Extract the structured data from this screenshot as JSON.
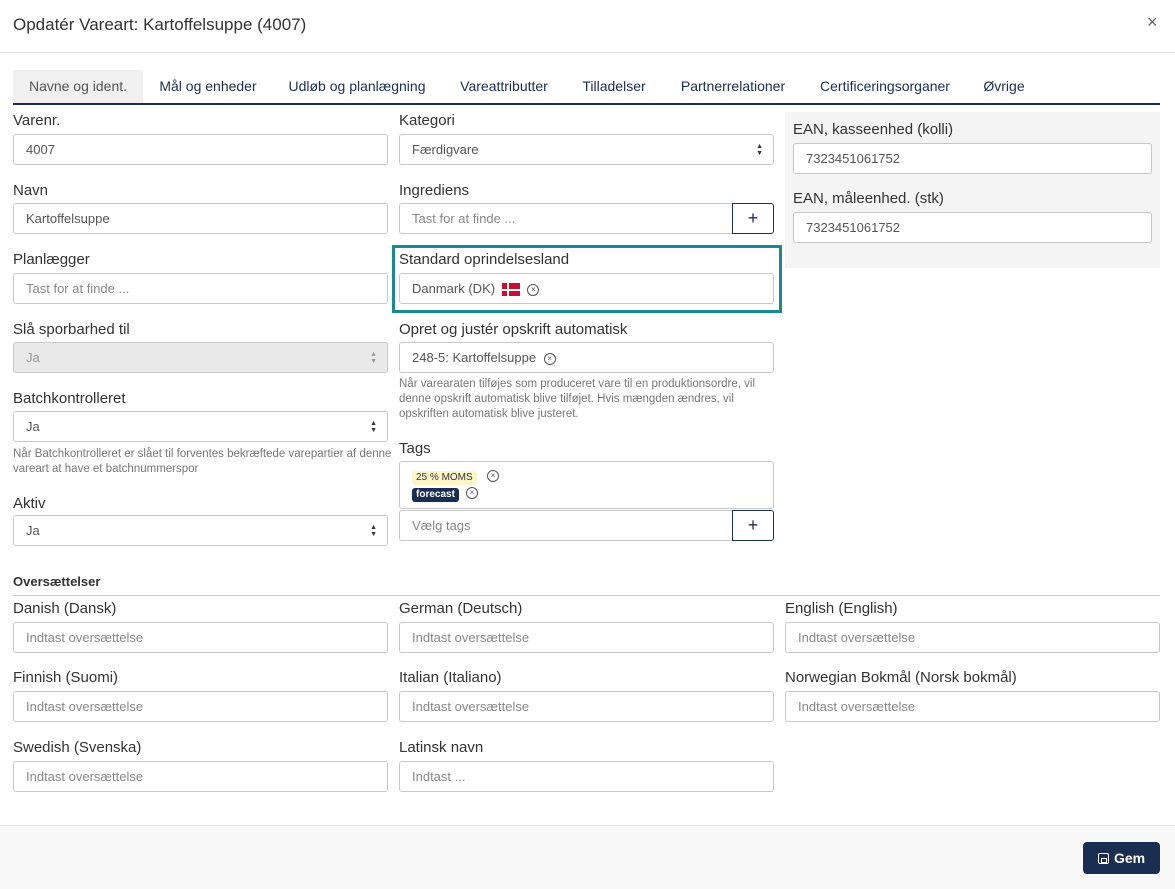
{
  "dialog": {
    "title": "Opdatér Vareart: Kartoffelsuppe (4007)",
    "close_glyph": "×"
  },
  "tabs": [
    {
      "label": "Navne og ident.",
      "active": true
    },
    {
      "label": "Mål og enheder"
    },
    {
      "label": "Udløb og planlægning"
    },
    {
      "label": "Vareattributter"
    },
    {
      "label": "Tilladelser"
    },
    {
      "label": "Partnerrelationer"
    },
    {
      "label": "Certificeringsorganer"
    },
    {
      "label": "Øvrige"
    }
  ],
  "form": {
    "varenr": {
      "label": "Varenr.",
      "value": "4007"
    },
    "navn": {
      "label": "Navn",
      "value": "Kartoffelsuppe"
    },
    "planlaegger": {
      "label": "Planlægger",
      "placeholder": "Tast for at finde ..."
    },
    "sporbarhed": {
      "label": "Slå sporbarhed til",
      "value": "Ja"
    },
    "batch": {
      "label": "Batchkontrolleret",
      "value": "Ja",
      "help": "Når Batchkontrolleret er slået til forventes bekræftede varepartier af denne vareart at have et batchnummerspor"
    },
    "aktiv": {
      "label": "Aktiv",
      "value": "Ja"
    },
    "kategori": {
      "label": "Kategori",
      "value": "Færdigvare"
    },
    "ingrediens": {
      "label": "Ingrediens",
      "placeholder": "Tast for at finde ..."
    },
    "oprindelsesland": {
      "label": "Standard oprindelsesland",
      "value": "Danmark (DK)"
    },
    "opskrift": {
      "label": "Opret og justér opskrift automatisk",
      "value": "248-5: Kartoffelsuppe",
      "help": "Når varearaten tilføjes som produceret vare til en produktionsordre, vil denne opskrift automatisk blive tilføjet. Hvis mængden ændres, vil opskriften automatisk blive justeret."
    },
    "tags": {
      "label": "Tags",
      "items": [
        "25 % MOMS",
        "forecast"
      ],
      "placeholder": "Vælg tags"
    },
    "ean_kolli": {
      "label": "EAN, kasseenhed (kolli)",
      "value": "7323451061752"
    },
    "ean_stk": {
      "label": "EAN, måleenhed. (stk)",
      "value": "7323451061752"
    }
  },
  "translations": {
    "title": "Oversættelser",
    "placeholder": "Indtast oversættelse",
    "fields": [
      {
        "label": "Danish (Dansk)"
      },
      {
        "label": "German (Deutsch)"
      },
      {
        "label": "English (English)"
      },
      {
        "label": "Finnish (Suomi)"
      },
      {
        "label": "Italian (Italiano)"
      },
      {
        "label": "Norwegian Bokmål (Norsk bokmål)"
      },
      {
        "label": "Swedish (Svenska)"
      }
    ],
    "latin": {
      "label": "Latinsk navn",
      "placeholder": "Indtast ..."
    }
  },
  "footer": {
    "save_label": "Gem"
  },
  "icons": {
    "plus": "+",
    "select_arrows": "◆",
    "remove": "×"
  },
  "colors": {
    "primary": "#1a2e52",
    "highlight": "#1b8a8f"
  }
}
